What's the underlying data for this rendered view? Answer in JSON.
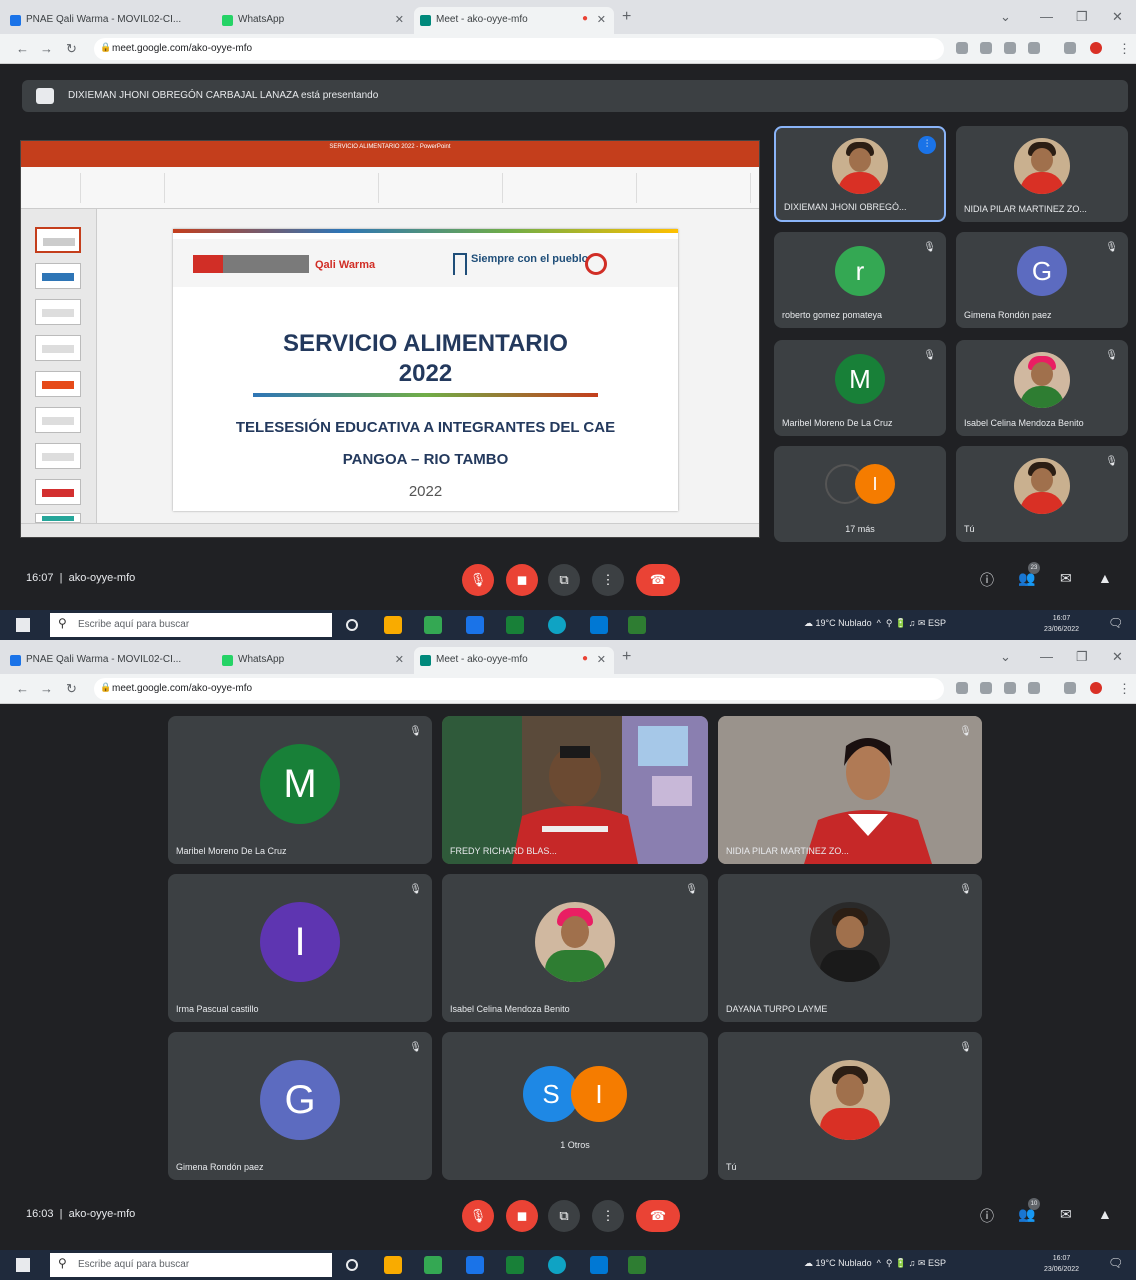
{
  "browser": {
    "tabs": [
      {
        "label": "PNAE Qali Warma - MOVIL02-CI..."
      },
      {
        "label": "WhatsApp"
      },
      {
        "label": "Meet - ako-oyye-mfo"
      }
    ],
    "url": "meet.google.com/ako-oyye-mfo"
  },
  "notice": {
    "text": "DIXIEMAN JHONI OBREGÓN CARBAJAL LANAZA está presentando"
  },
  "slide": {
    "window_title": "SERVICIO ALIMENTARIO 2022 - PowerPoint",
    "logo_gob": "Qali Warma",
    "logo_siempre": "Siempre con el pueblo",
    "title_line1": "SERVICIO ALIMENTARIO",
    "title_line2": "2022",
    "subtitle": "TELESESIÓN EDUCATIVA A INTEGRANTES DEL CAE",
    "place": "PANGOA – RIO TAMBO",
    "year": "2022"
  },
  "screen1": {
    "time": "16:07",
    "meeting_code": "ako-oyye-mfo",
    "participants": [
      {
        "name": "DIXIEMAN JHONI OBREGÓ...",
        "kind": "photo",
        "speaking": true
      },
      {
        "name": "NIDIA PILAR MARTINEZ ZO...",
        "kind": "photo"
      },
      {
        "name": "roberto gomez pomateya",
        "kind": "letter",
        "letter": "r",
        "color": "#34a853"
      },
      {
        "name": "Gimena Rondón paez",
        "kind": "letter",
        "letter": "G",
        "color": "#5c6bc0"
      },
      {
        "name": "Maribel Moreno De La Cruz",
        "kind": "letter",
        "letter": "M",
        "color": "#188038"
      },
      {
        "name": "Isabel Celina Mendoza Benito",
        "kind": "photo"
      },
      {
        "name": "17 más",
        "kind": "pair",
        "a_color": "#202124",
        "b_color": "#f57c00",
        "b_letter": "I"
      },
      {
        "name": "Tú",
        "kind": "photo"
      }
    ],
    "people_count": "23"
  },
  "screen2": {
    "time": "16:03",
    "meeting_code": "ako-oyye-mfo",
    "participants": [
      {
        "name": "Maribel Moreno De La Cruz",
        "kind": "letter",
        "letter": "M",
        "color": "#188038"
      },
      {
        "name": "FREDY RICHARD BLAS...",
        "kind": "video"
      },
      {
        "name": "NIDIA PILAR MARTINEZ ZO...",
        "kind": "video"
      },
      {
        "name": "Irma Pascual castillo",
        "kind": "letter",
        "letter": "I",
        "color": "#5e35b1"
      },
      {
        "name": "Isabel Celina Mendoza Benito",
        "kind": "photo"
      },
      {
        "name": "DAYANA TURPO LAYME",
        "kind": "photo"
      },
      {
        "name": "Gimena Rondón paez",
        "kind": "letter",
        "letter": "G",
        "color": "#5c6bc0"
      },
      {
        "name": "1 Otros",
        "kind": "pair",
        "a_color": "#1e88e5",
        "a_letter": "S",
        "b_color": "#f57c00",
        "b_letter": "I"
      },
      {
        "name": "Tú",
        "kind": "photo"
      }
    ],
    "people_count": "10"
  },
  "taskbar": {
    "search_placeholder": "Escribe aquí para buscar",
    "weather": "19°C Nublado",
    "lang": "ESP",
    "clock_time": "16:07",
    "clock_date": "23/06/2022"
  }
}
